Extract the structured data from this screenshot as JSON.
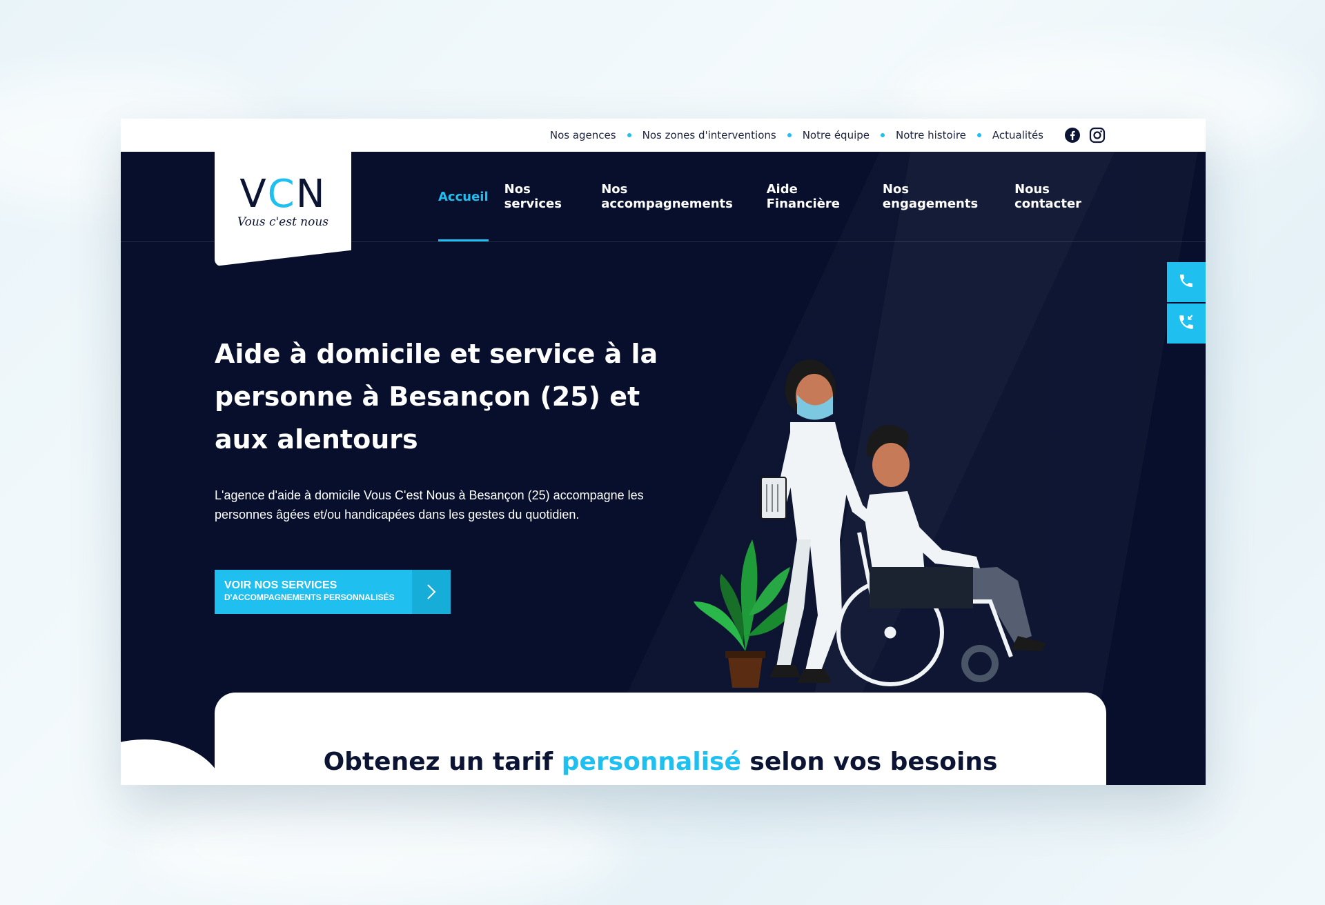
{
  "topbar": {
    "links": [
      "Nos agences",
      "Nos zones d'interventions",
      "Notre équipe",
      "Notre histoire",
      "Actualités"
    ],
    "social": [
      "facebook-icon",
      "instagram-icon"
    ]
  },
  "logo": {
    "mark_left": "V",
    "mark_accent": "C",
    "mark_right": "N",
    "tagline": "Vous c'est nous"
  },
  "nav": {
    "items": [
      "Accueil",
      "Nos services",
      "Nos accompagnements",
      "Aide Financière",
      "Nos engagements",
      "Nous contacter"
    ],
    "active_index": 0
  },
  "side_buttons": [
    "phone-icon",
    "phone-incoming-icon"
  ],
  "hero": {
    "title": "Aide à domicile et service à la personne à Besançon (25) et aux alentours",
    "description": "L'agence d'aide à domicile Vous C'est Nous à Besançon (25) accompagne les personnes âgées et/ou handicapées dans les gestes du quotidien.",
    "cta_line1": "Voir nos services",
    "cta_line2": "d'accompagnements personnalisés"
  },
  "card": {
    "title_before": "Obtenez un tarif ",
    "title_highlight": "personnalisé",
    "title_after": " selon vos besoins"
  },
  "colors": {
    "accent": "#1fc0ef",
    "navy": "#070f2c",
    "white": "#ffffff"
  }
}
